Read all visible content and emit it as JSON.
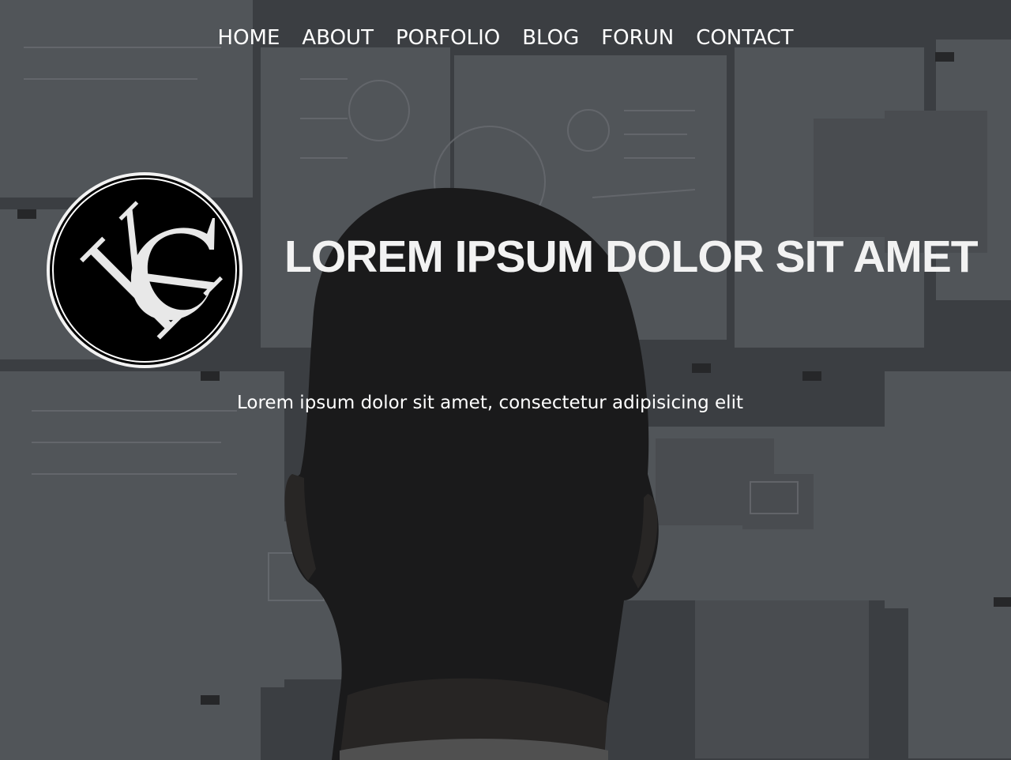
{
  "nav": {
    "items": [
      {
        "label": "HOME"
      },
      {
        "label": "ABOUT"
      },
      {
        "label": "PORFOLIO"
      },
      {
        "label": "BLOG"
      },
      {
        "label": "FORUN"
      },
      {
        "label": "CONTACT"
      }
    ]
  },
  "logo": {
    "icon": "kc-monogram-logo",
    "letters": "KC"
  },
  "hero": {
    "title": "LOREM IPSUM DOLOR SIT AMET",
    "subtitle": "Lorem ipsum dolor sit amet, consectetur adipisicing elit"
  },
  "colors": {
    "background": "#4a4d52",
    "text": "#ffffff",
    "logo_fill": "#000000"
  }
}
